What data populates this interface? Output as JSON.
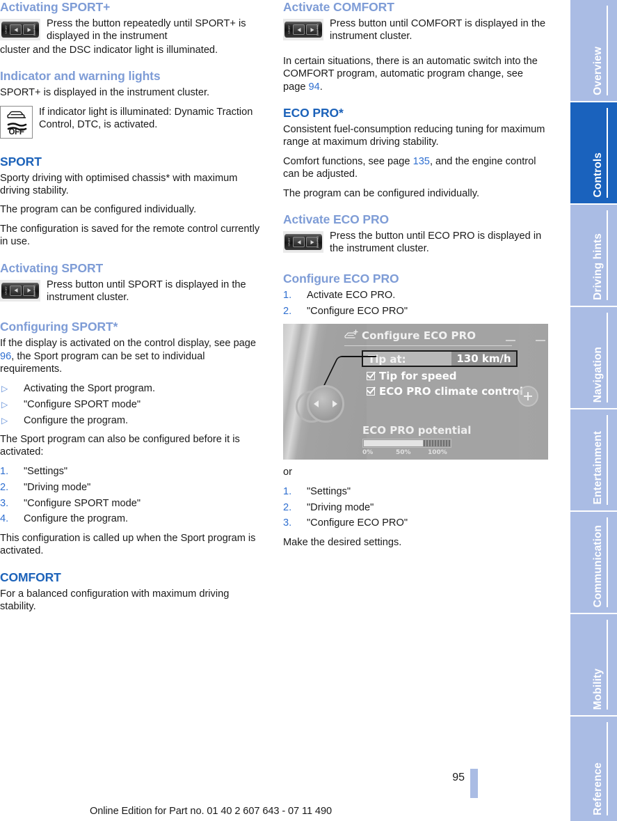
{
  "document": {
    "page_number": "95",
    "footer_text": "Online Edition for Part no. 01 40 2 607 643 - 07 11 490"
  },
  "colors": {
    "heading_primary": "#1c62b9",
    "heading_secondary": "#7e9cd6",
    "cross_reference": "#2f6fd0",
    "tab_inactive": "#aabce4",
    "tab_active": "#1a62bd"
  },
  "left_column": {
    "activating_sport_plus": {
      "heading": "Activating SPORT+",
      "icon_text": "Press the button repeatedly until SPORT+ is displayed in the instrument",
      "continuation": "cluster and the DSC indicator light is illuminated."
    },
    "indicator_warning": {
      "heading": "Indicator and warning lights",
      "paragraph": "SPORT+ is displayed in the instrument cluster.",
      "icon_label": "OFF",
      "icon_text": "If indicator light is illuminated: Dynamic Traction Control, DTC, is activated."
    },
    "sport": {
      "heading": "SPORT",
      "paragraphs": [
        "Sporty driving with optimised chassis* with maximum driving stability.",
        "The program can be configured individually.",
        "The configuration is saved for the remote control currently in use."
      ]
    },
    "activating_sport": {
      "heading": "Activating SPORT",
      "icon_text": "Press button until SPORT is displayed in the instrument cluster."
    },
    "configuring_sport": {
      "heading": "Configuring SPORT*",
      "intro_before": "If the display is activated on the control display, see page ",
      "intro_link": "96",
      "intro_after": ", the Sport program can be set to individual requirements.",
      "bullets": [
        "Activating the Sport program.",
        "\"Configure SPORT mode\"",
        "Configure the program."
      ],
      "before_steps": "The Sport program can also be configured before it is activated:",
      "steps": [
        "\"Settings\"",
        "\"Driving mode\"",
        "\"Configure SPORT mode\"",
        "Configure the program."
      ],
      "closing": "This configuration is called up when the Sport program is activated."
    },
    "comfort": {
      "heading": "COMFORT",
      "paragraph": "For a balanced configuration with maximum driving stability."
    }
  },
  "right_column": {
    "activate_comfort": {
      "heading": "Activate COMFORT",
      "icon_text": "Press button until COMFORT is displayed in the instrument cluster.",
      "note_before": "In certain situations, there is an automatic switch into the COMFORT program, automatic program change, see page ",
      "note_link": "94",
      "note_after": "."
    },
    "eco_pro": {
      "heading": "ECO PRO*",
      "paragraph1": "Consistent fuel-consumption reducing tuning for maximum range at maximum driving stability.",
      "paragraph2_before": "Comfort functions, see page ",
      "paragraph2_link": "135",
      "paragraph2_after": ", and the engine control can be adjusted.",
      "paragraph3": "The program can be configured individually."
    },
    "activate_eco_pro": {
      "heading": "Activate ECO PRO",
      "icon_text": "Press the button until ECO PRO is displayed in the instrument cluster."
    },
    "configure_eco_pro": {
      "heading": "Configure ECO PRO",
      "steps": [
        "Activate ECO PRO.",
        "\"Configure ECO PRO\""
      ],
      "or_text": "or",
      "steps2": [
        "\"Settings\"",
        "\"Driving mode\"",
        "\"Configure ECO PRO\""
      ],
      "closing": "Make the desired settings."
    }
  },
  "eco_pro_screen": {
    "title": "Configure ECO PRO",
    "tip_label": "Tip at:",
    "tip_value": "130 km/h",
    "checkbox1": "Tip for speed",
    "checkbox2": "ECO PRO climate control",
    "potential_label": "ECO PRO potential",
    "scale_0": "0%",
    "scale_50": "50%",
    "scale_100": "100%"
  },
  "sidebar": {
    "tabs": [
      {
        "label": "Overview",
        "active": false
      },
      {
        "label": "Controls",
        "active": true
      },
      {
        "label": "Driving hints",
        "active": false
      },
      {
        "label": "Navigation",
        "active": false
      },
      {
        "label": "Entertainment",
        "active": false
      },
      {
        "label": "Communication",
        "active": false
      },
      {
        "label": "Mobility",
        "active": false
      },
      {
        "label": "Reference",
        "active": false
      }
    ]
  }
}
